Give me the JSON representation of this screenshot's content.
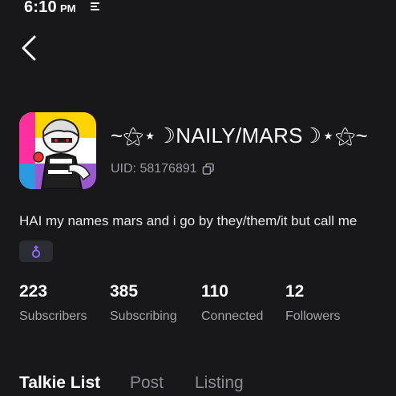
{
  "status_bar": {
    "time": "6:10",
    "ampm": "PM",
    "notification_icon": "notification-lines-icon"
  },
  "nav": {
    "back_icon": "chevron-left-icon"
  },
  "profile": {
    "name": "~⚝⋆☽NAILY/MARS☽⋆⚝~",
    "uid": "UID: 58176891",
    "uid_copy_icon": "copy-icon",
    "bio": "HAI my names mars and i go by they/them/it but call me",
    "badge_icon": "pronoun-symbol-icon",
    "avatar_colors": {
      "top": "#ffd400",
      "middle": "#ffffff",
      "bottom": "#9b59d0",
      "left": "#ff2fa0"
    }
  },
  "stats": [
    {
      "value": "223",
      "label": "Subscribers"
    },
    {
      "value": "385",
      "label": "Subscribing"
    },
    {
      "value": "110",
      "label": "Connected"
    },
    {
      "value": "12",
      "label": "Followers"
    }
  ],
  "tabs": [
    {
      "label": "Talkie List",
      "active": true
    },
    {
      "label": "Post",
      "active": false
    },
    {
      "label": "Listing",
      "active": false
    }
  ],
  "colors": {
    "background": "#18181b",
    "secondary_text": "#a3a3aa",
    "badge_bg": "#2c2c33",
    "badge_accent": "#8c6cf5"
  }
}
